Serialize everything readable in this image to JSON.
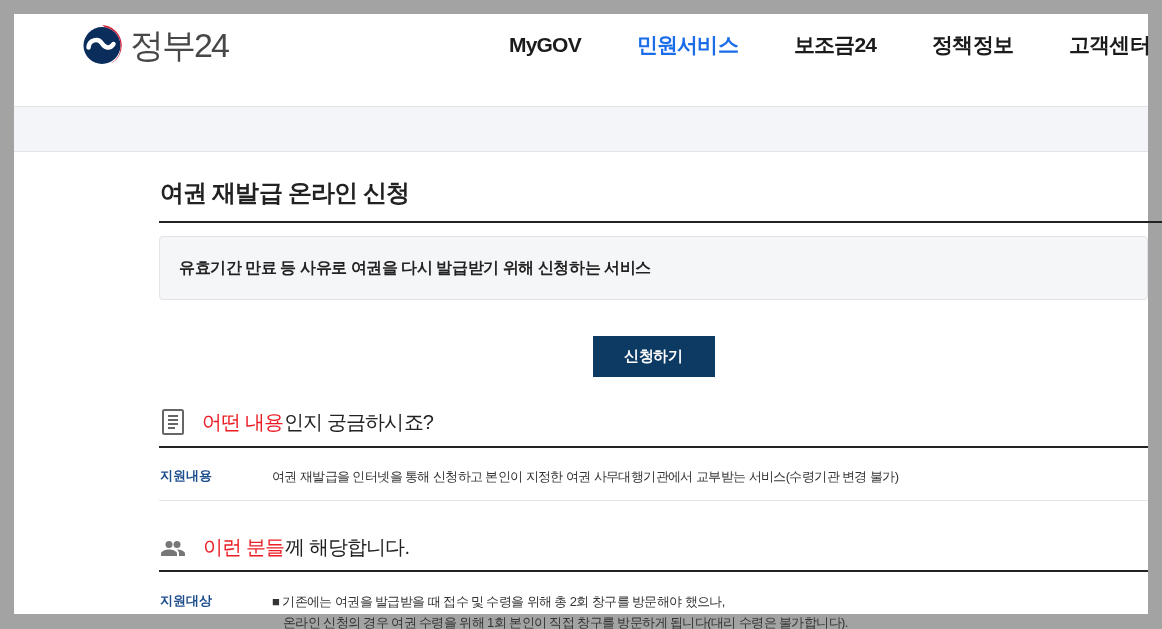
{
  "header": {
    "logo_text": "정부24",
    "nav": [
      {
        "label": "MyGOV",
        "selected": false
      },
      {
        "label": "민원서비스",
        "selected": true
      },
      {
        "label": "보조금24",
        "selected": false
      },
      {
        "label": "정책정보",
        "selected": false
      },
      {
        "label": "고객센터",
        "selected": false
      }
    ]
  },
  "page": {
    "title": "여권 재발급 온라인 신청",
    "summary": "유효기간 만료 등 사유로 여권을 다시 발급받기 위해 신청하는 서비스",
    "apply_button": "신청하기"
  },
  "sections": [
    {
      "kind": "content",
      "heading": {
        "highlight": "어떤 내용",
        "rest": "인지 궁금하시죠?"
      },
      "rows": [
        {
          "label": "지원내용",
          "lines": [
            "여권 재발급을 인터넷을 통해 신청하고 본인이 지정한 여권 사무대행기관에서 교부받는 서비스(수령기관 변경 불가)"
          ]
        }
      ]
    },
    {
      "kind": "audience",
      "heading": {
        "highlight": "이런 분들",
        "rest": "께 해당합니다."
      },
      "rows": [
        {
          "label": "지원대상",
          "lines": [
            "■ 기존에는 여권을 발급받을 때 접수 및 수령을 위해 총 2회 창구를 방문해야 했으나,",
            "온라인 신청의 경우 여권 수령을 위해 1회 본인이 직접 창구를 방문하게 됩니다(대리 수령은 불가합니다)."
          ]
        }
      ]
    }
  ]
}
